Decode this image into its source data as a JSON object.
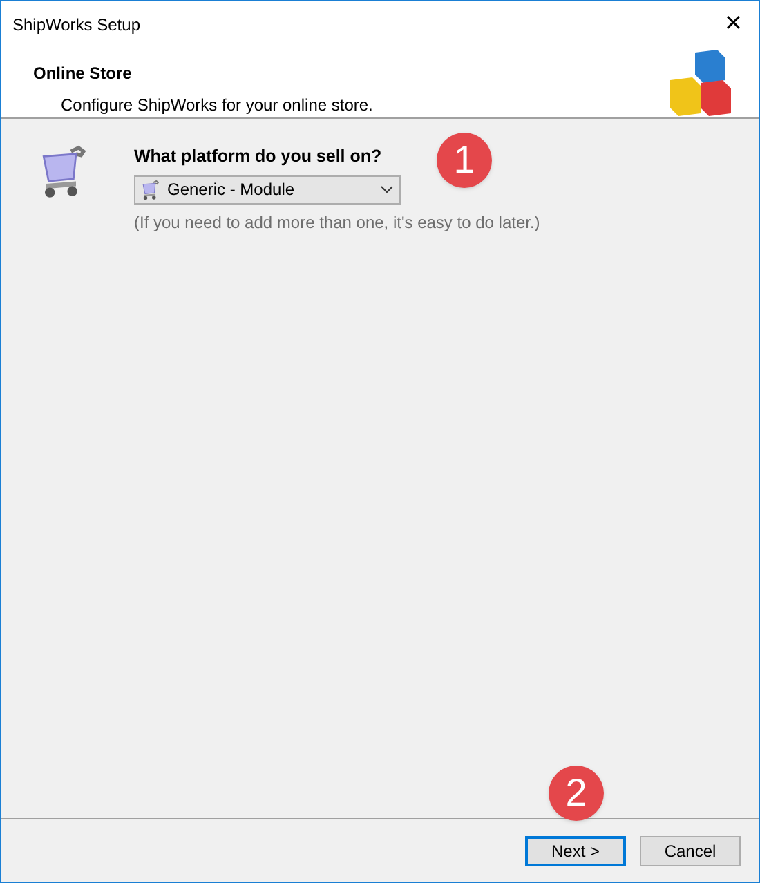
{
  "window": {
    "title": "ShipWorks Setup",
    "close": "✕"
  },
  "header": {
    "title": "Online Store",
    "subtitle": "Configure ShipWorks for your online store."
  },
  "platform": {
    "question": "What platform do you sell on?",
    "value": "Generic - Module",
    "hint": "(If you need to add more than one, it's easy to do later.)"
  },
  "callouts": [
    "1",
    "2"
  ],
  "buttons": [
    {
      "label": "Next >",
      "focused": true
    },
    {
      "label": "Cancel",
      "focused": false
    }
  ]
}
